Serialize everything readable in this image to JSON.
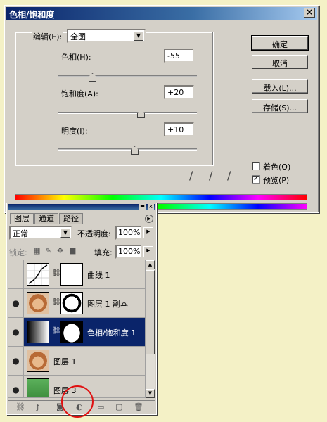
{
  "dialog": {
    "title": "色相/饱和度",
    "edit_label": "编辑(E):",
    "edit_value": "全图",
    "hue_label": "色相(H):",
    "hue_value": "-55",
    "saturation_label": "饱和度(A):",
    "saturation_value": "+20",
    "lightness_label": "明度(I):",
    "lightness_value": "+10",
    "ok": "确定",
    "cancel": "取消",
    "load": "载入(L)...",
    "save": "存储(S)...",
    "colorize_label": "着色(O)",
    "colorize_checked": false,
    "preview_label": "预览(P)",
    "preview_checked": true,
    "close_glyph": "×",
    "hue_slider_level": -55,
    "saturation_slider_level": 20,
    "lightness_slider_level": 10
  },
  "layers_panel": {
    "tabs": [
      "图层",
      "通道",
      "路径"
    ],
    "blend_mode": "正常",
    "opacity_label": "不透明度:",
    "opacity_value": "100%",
    "lock_label": "锁定:",
    "fill_label": "填充:",
    "fill_value": "100%",
    "layers": [
      {
        "name": "曲线 1",
        "visible": false
      },
      {
        "name": "图层 1 副本",
        "visible": true
      },
      {
        "name": "色相/饱和度 1",
        "visible": true,
        "selected": true
      },
      {
        "name": "图层 1",
        "visible": true
      },
      {
        "name": "图层 3",
        "visible": true
      }
    ]
  },
  "colors": {
    "selection": "#0a246a",
    "highlight_circle": "#e01010",
    "background": "#f4f1c6"
  }
}
